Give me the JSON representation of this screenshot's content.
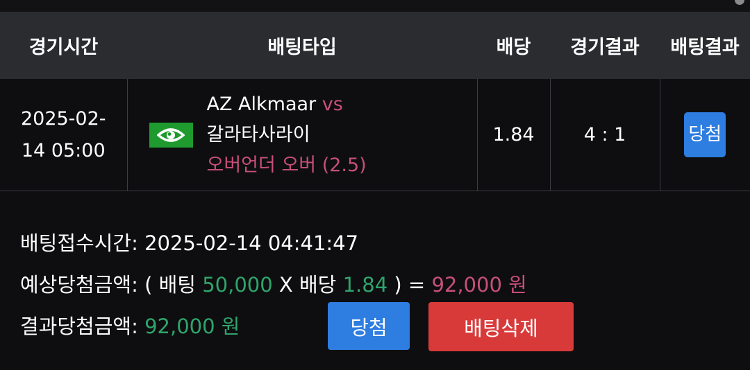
{
  "table": {
    "headers": {
      "time": "경기시간",
      "type": "배팅타입",
      "odds": "배당",
      "result": "경기결과",
      "bet_result": "배팅결과"
    },
    "row": {
      "date": "2025-02-",
      "time": "14 05:00",
      "home_team": "AZ Alkmaar",
      "vs": "vs",
      "away_team": "갈라타사라이",
      "pick": "오버언더 오버 (2.5)",
      "odds": "1.84",
      "score": "4 : 1",
      "bet_result": "당첨",
      "icon": "eye-icon"
    }
  },
  "summary": {
    "received_label": "배팅접수시간:",
    "received_value": "2025-02-14 04:41:47",
    "expected_label": "예상당첨금액:",
    "open_paren": "( 배팅",
    "stake": "50,000",
    "x_odds": "X 배당",
    "odds": "1.84",
    "close_eq": ") =",
    "expected_win": "92,000 원",
    "result_label": "결과당첨금액:",
    "result_win": "92,000 원"
  },
  "buttons": {
    "win_label": "당첨",
    "delete_label": "배팅삭제"
  },
  "colors": {
    "accent_blue": "#2e7de0",
    "danger_red": "#d83a3a",
    "green_text": "#2fa56c",
    "pink_text": "#c74f79"
  }
}
